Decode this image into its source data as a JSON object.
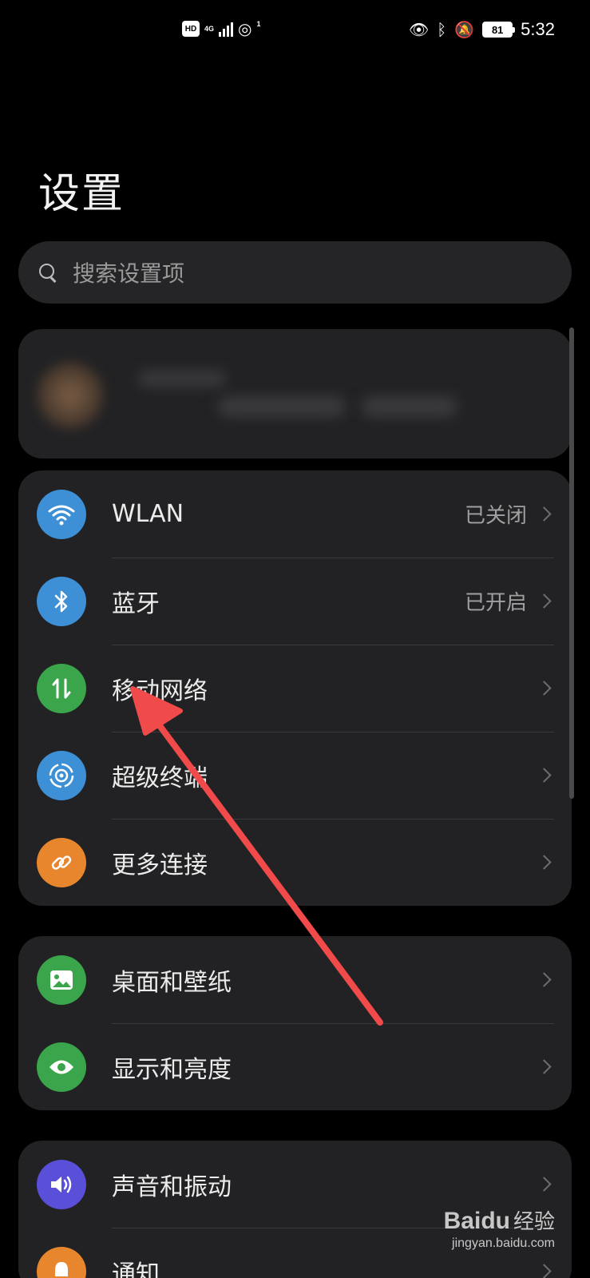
{
  "status_bar": {
    "hd_badge": "HD",
    "network_type": "4G",
    "hotspot_count": "1",
    "battery": "81",
    "time": "5:32"
  },
  "page_title": "设置",
  "search": {
    "placeholder": "搜索设置项"
  },
  "groups": [
    {
      "items": [
        {
          "label": "WLAN",
          "status": "已关闭",
          "icon": "wifi-icon",
          "color": "#3d8fd6"
        },
        {
          "label": "蓝牙",
          "status": "已开启",
          "icon": "bluetooth-icon",
          "color": "#3d8fd6"
        },
        {
          "label": "移动网络",
          "status": "",
          "icon": "mobile-data-icon",
          "color": "#3aa54a"
        },
        {
          "label": "超级终端",
          "status": "",
          "icon": "super-device-icon",
          "color": "#3d8fd6"
        },
        {
          "label": "更多连接",
          "status": "",
          "icon": "link-icon",
          "color": "#e8862e"
        }
      ]
    },
    {
      "items": [
        {
          "label": "桌面和壁纸",
          "status": "",
          "icon": "image-icon",
          "color": "#3aa54a"
        },
        {
          "label": "显示和亮度",
          "status": "",
          "icon": "eye-icon",
          "color": "#3aa54a"
        }
      ]
    },
    {
      "items": [
        {
          "label": "声音和振动",
          "status": "",
          "icon": "speaker-icon",
          "color": "#5a4fd8"
        },
        {
          "label": "通知",
          "status": "",
          "icon": "bell-icon",
          "color": "#e8862e"
        }
      ]
    }
  ],
  "watermark": {
    "logo": "Baidu",
    "logo_suffix": "经验",
    "url": "jingyan.baidu.com"
  },
  "annotation_color": "#f04a4a"
}
